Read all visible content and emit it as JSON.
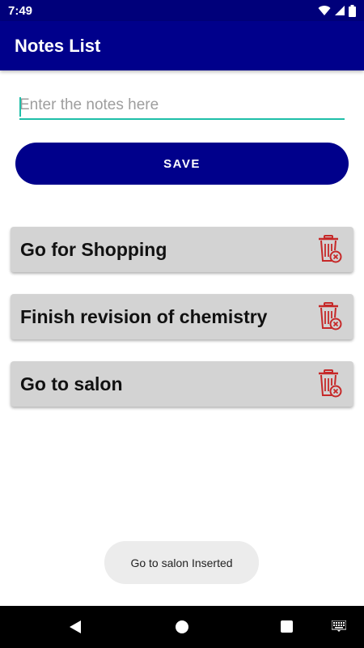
{
  "status_bar": {
    "time": "7:49",
    "icons": [
      "wifi-icon",
      "signal-icon",
      "battery-icon"
    ]
  },
  "app_bar": {
    "title": "Notes List"
  },
  "input": {
    "value": "",
    "placeholder": "Enter the notes here"
  },
  "save_button": {
    "label": "SAVE"
  },
  "notes": [
    {
      "text": "Go for Shopping"
    },
    {
      "text": "Finish revision of chemistry"
    },
    {
      "text": "Go to salon"
    }
  ],
  "toast": {
    "text": "Go to salon Inserted"
  },
  "colors": {
    "primary": "#00008b",
    "accent": "#1fbfa8",
    "card": "#d3d3d3",
    "delete_icon": "#c62828"
  }
}
